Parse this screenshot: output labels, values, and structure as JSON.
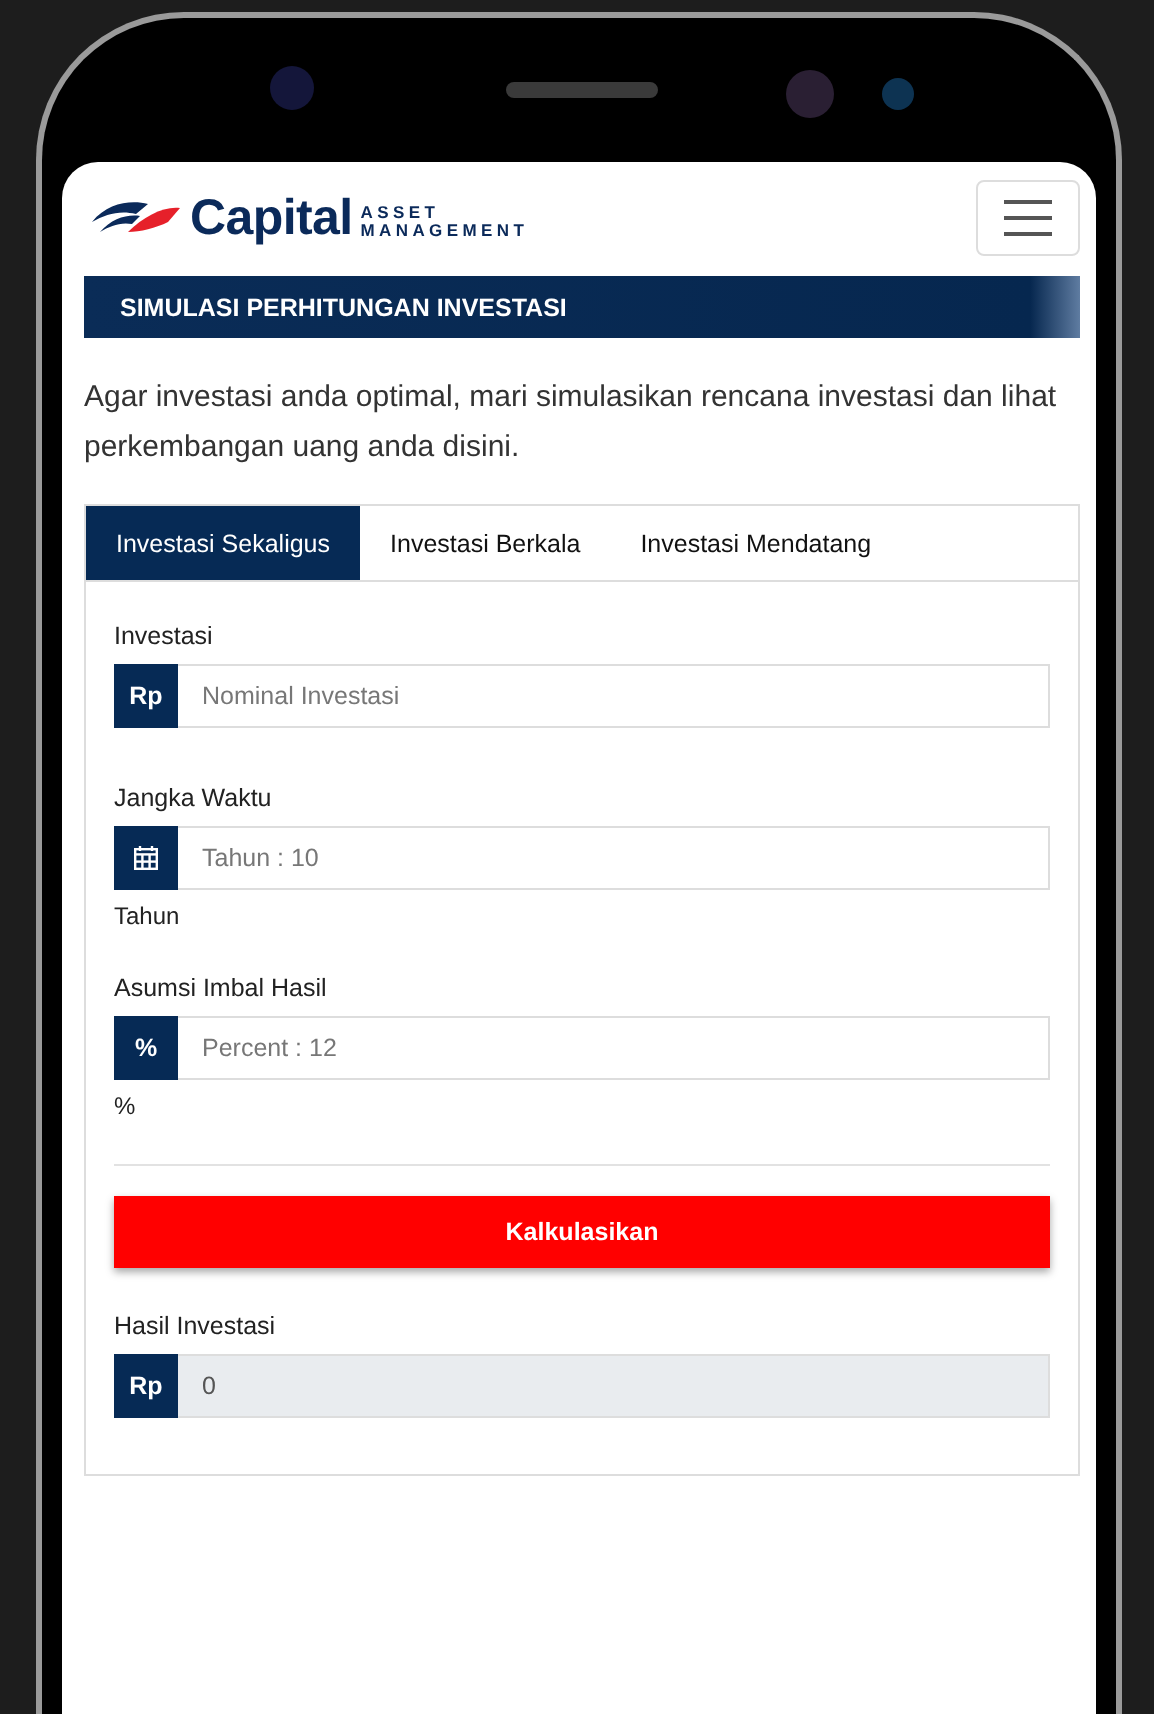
{
  "header": {
    "logo": {
      "name": "Capital",
      "tagline_top": "ASSET",
      "tagline_bottom": "MANAGEMENT"
    }
  },
  "banner": {
    "title": "SIMULASI PERHITUNGAN INVESTASI"
  },
  "intro": "Agar investasi anda optimal, mari simulasikan rencana investasi dan lihat perkembangan uang anda disini.",
  "tabs": [
    {
      "label": "Investasi Sekaligus",
      "selected": true
    },
    {
      "label": "Investasi Berkala",
      "selected": false
    },
    {
      "label": "Investasi Mendatang",
      "selected": false
    }
  ],
  "fields": [
    {
      "label": "Investasi",
      "addon": {
        "kind": "text",
        "text": "Rp"
      },
      "placeholder": "Nominal Investasi"
    },
    {
      "label": "Jangka Waktu",
      "addon": {
        "kind": "calendar"
      },
      "placeholder": "Tahun : 10",
      "unit": "Tahun"
    },
    {
      "label": "Asumsi Imbal Hasil",
      "addon": {
        "kind": "text",
        "text": "%"
      },
      "placeholder": "Percent : 12",
      "unit": "%"
    }
  ],
  "button": {
    "label": "Kalkulasikan"
  },
  "result": {
    "label": "Hasil Investasi",
    "addon": {
      "kind": "text",
      "text": "Rp"
    },
    "value": "0",
    "readonly": true
  }
}
